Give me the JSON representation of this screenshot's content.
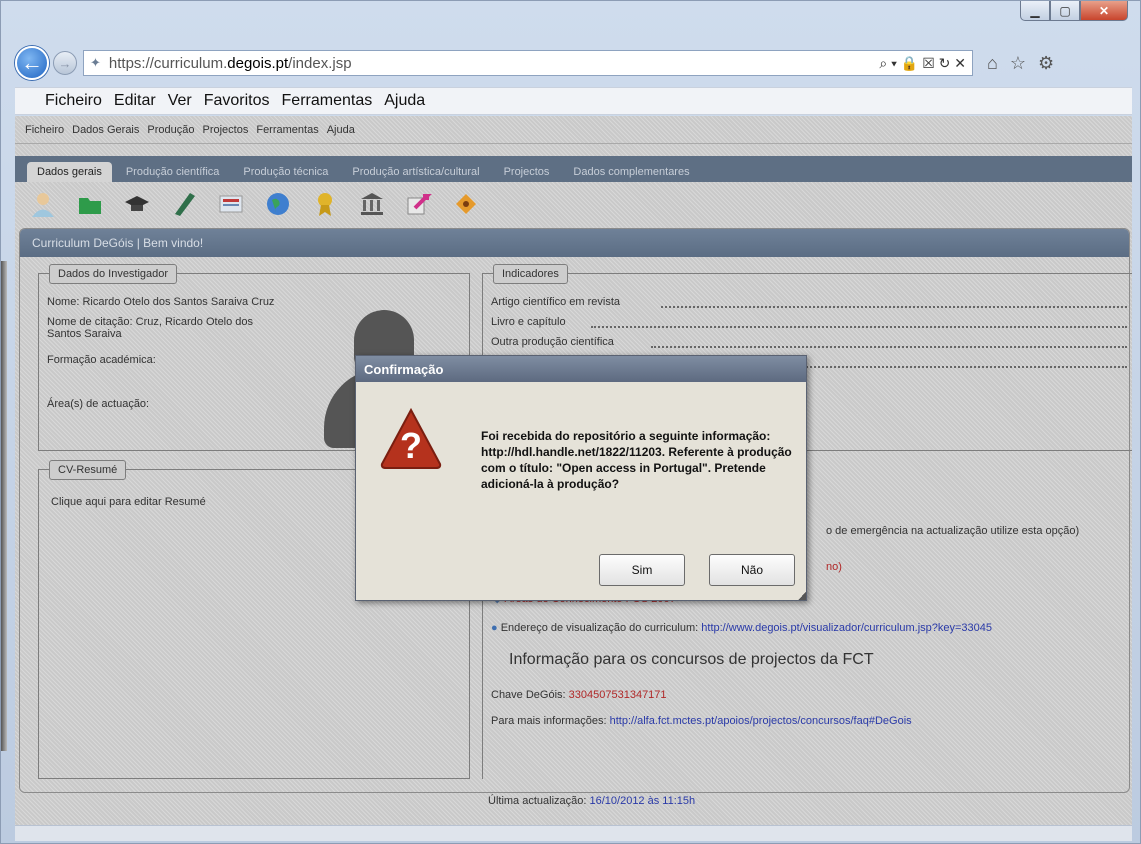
{
  "browser": {
    "url_prefix": "https://curriculum.",
    "url_host": "degois.pt",
    "url_path": "/index.jsp",
    "address_icons": "⌕ ▾ 🔒 ☒ ↻ ✕",
    "menu": [
      "Ficheiro",
      "Editar",
      "Ver",
      "Favoritos",
      "Ferramentas",
      "Ajuda"
    ]
  },
  "app": {
    "menu": [
      "Ficheiro",
      "Dados Gerais",
      "Produção",
      "Projectos",
      "Ferramentas",
      "Ajuda"
    ],
    "tabs": [
      "Dados gerais",
      "Produção científica",
      "Produção técnica",
      "Produção artística/cultural",
      "Projectos",
      "Dados complementares"
    ],
    "welcome_title": "Curriculum DeGóis | Bem vindo!"
  },
  "investigador": {
    "legend": "Dados do Investigador",
    "nome": "Nome: Ricardo Otelo dos Santos Saraiva Cruz",
    "citacao_line1": "Nome de citação: Cruz, Ricardo Otelo dos",
    "citacao_line2": "Santos Saraiva",
    "formacao": "Formação académica:",
    "area": "Área(s) de actuação:"
  },
  "indicadores": {
    "legend": "Indicadores",
    "items": [
      "Artigo científico em revista",
      "Livro e capítulo",
      "Outra produção científica"
    ]
  },
  "cv": {
    "legend": "CV-Resumé",
    "hint": "Clique aqui para editar Resumé"
  },
  "right_panel": {
    "emergencia": "o de emergência na actualização utilize esta opção)",
    "red_fragment": "no)",
    "areas": "Áreas de Conhecimento FOS 2007",
    "endereco_label": "Endereço de visualização do curriculum:",
    "endereco_link": "http://www.degois.pt/visualizador/curriculum.jsp?key=33045",
    "fct_title": "Informação para os concursos de projectos da FCT",
    "chave_label": "Chave DeGóis:",
    "chave_value": "3304507531347171",
    "mais_label": "Para mais informações:",
    "mais_link": "http://alfa.fct.mctes.pt/apoios/projectos/concursos/faq#DeGois",
    "ultima_label": "Última actualização:",
    "ultima_value": "16/10/2012 às 11:15h"
  },
  "dialog": {
    "title": "Confirmação",
    "message": "Foi recebida do repositório a seguinte informação: http://hdl.handle.net/1822/11203. Referente à produção com o título: \"Open access in Portugal\". Pretende adicioná-la à produção?",
    "yes": "Sim",
    "no": "Não"
  },
  "colors": {
    "dialog_icon": "#b5321d",
    "title_bar": "#5d6a80"
  }
}
